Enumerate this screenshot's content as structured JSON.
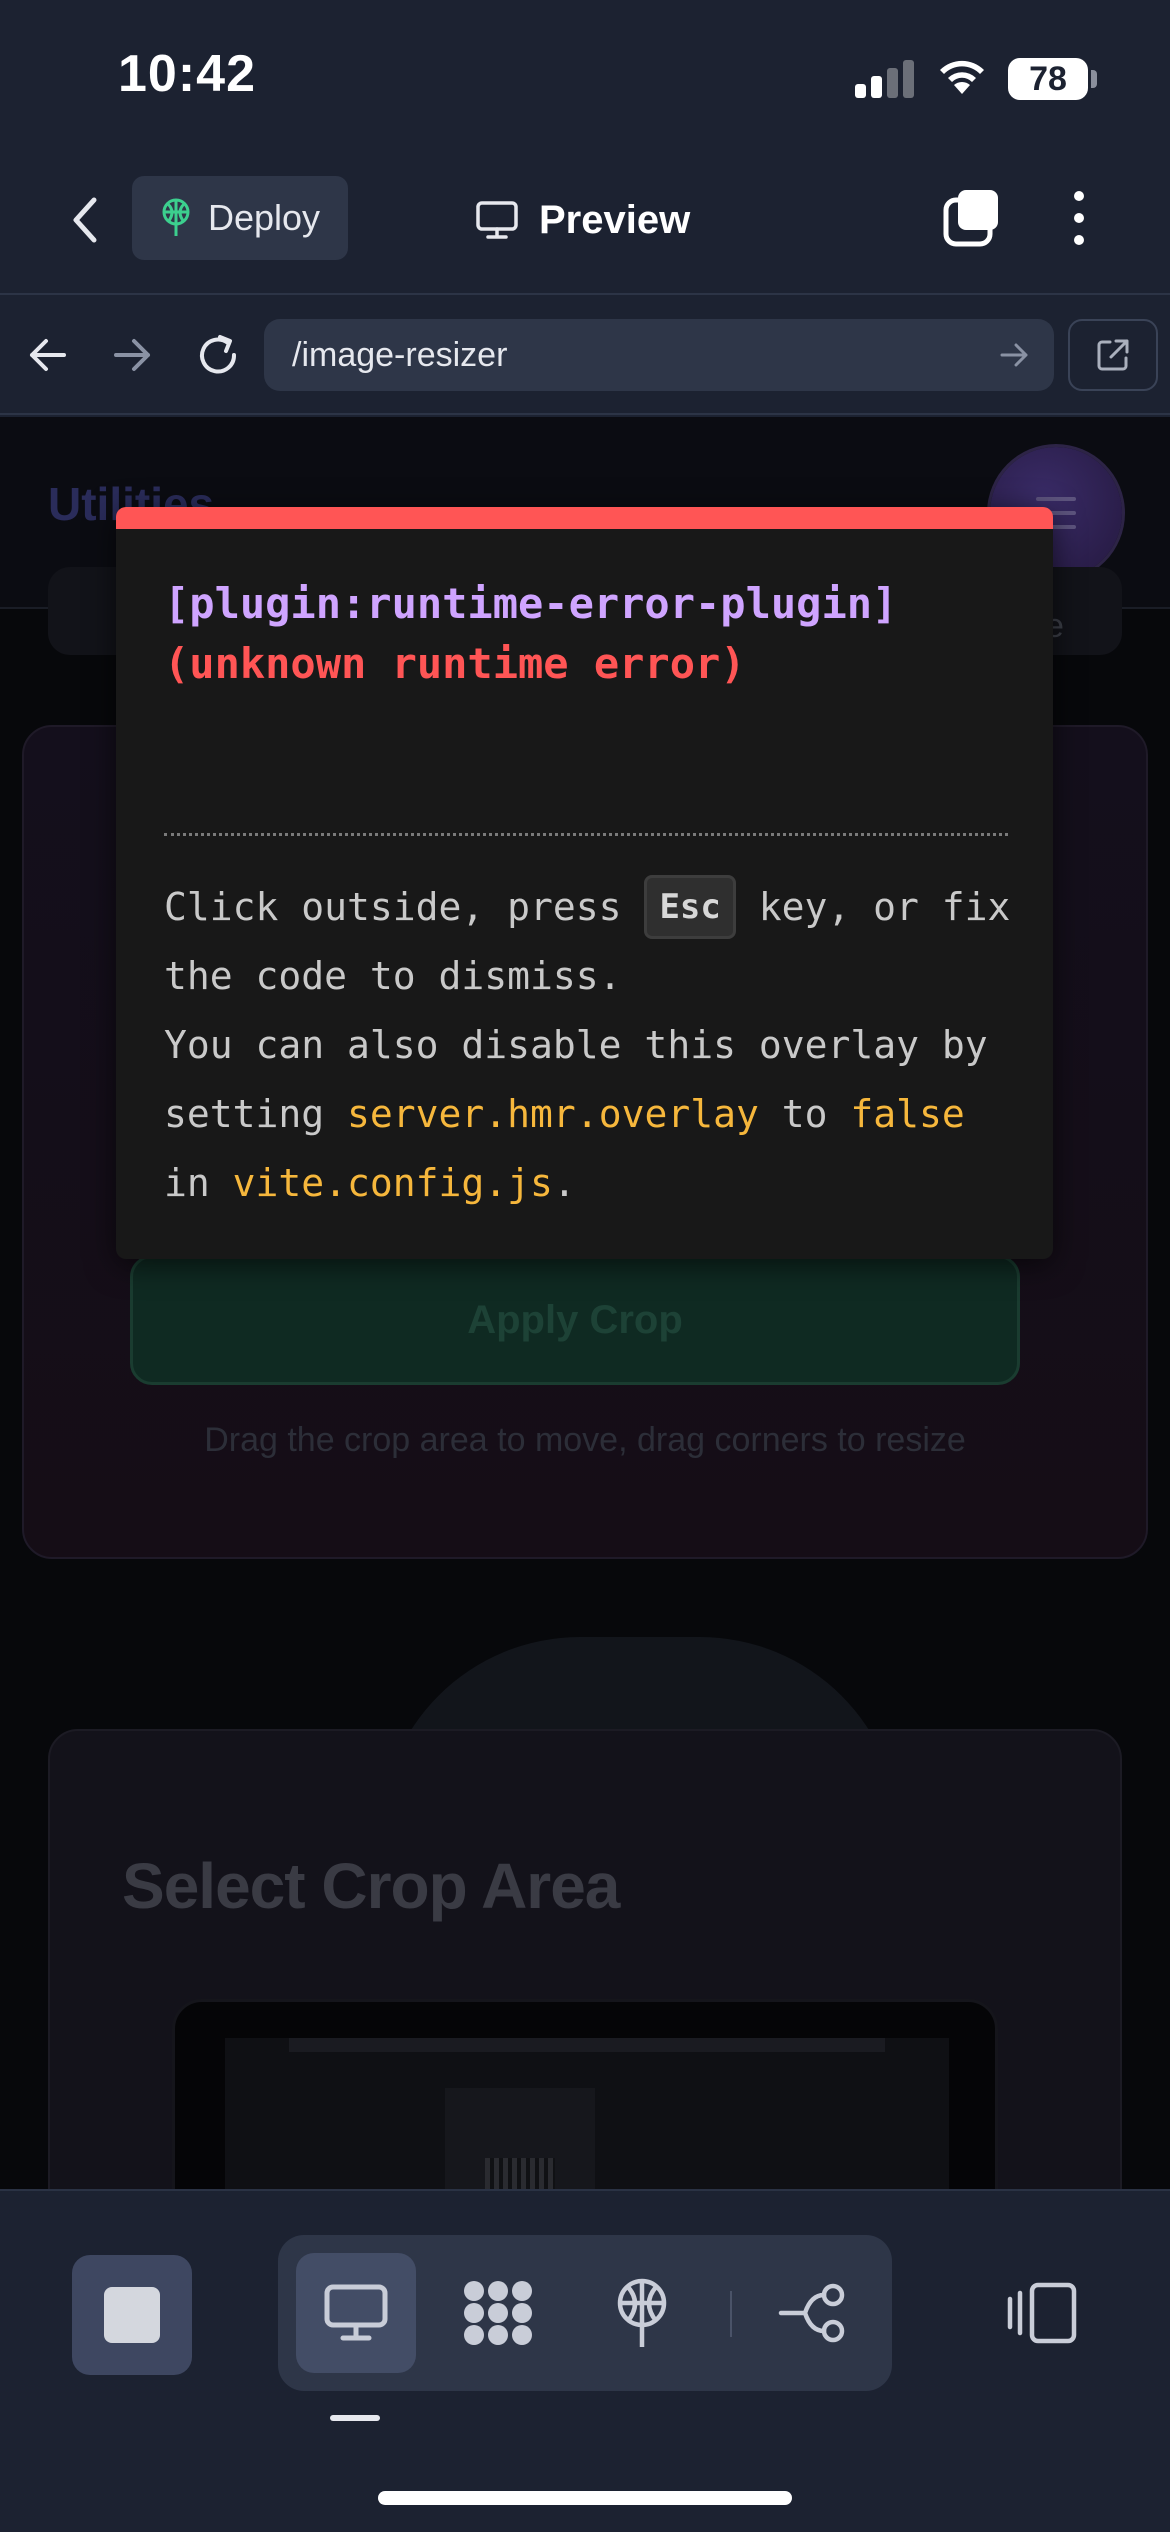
{
  "status_bar": {
    "time": "10:42",
    "battery": "78"
  },
  "app_bar": {
    "deploy_label": "Deploy",
    "preview_label": "Preview"
  },
  "url_bar": {
    "path": "/image-resizer"
  },
  "site": {
    "logo": "Utilities",
    "apply_crop_label": "Apply Crop",
    "crop_hint": "Drag the crop area to move, drag corners to resize",
    "select_crop_title": "Select Crop Area"
  },
  "error_overlay": {
    "plugin": "[plugin:runtime-error-plugin]",
    "message": "(unknown runtime error)",
    "tip_part1": "Click outside, press ",
    "tip_key": "Esc",
    "tip_part2": " key, or fix the code to dismiss.",
    "tip_part3": "You can also disable this overlay by setting ",
    "tip_code1": "server.hmr.overlay",
    "tip_part4": " to ",
    "tip_code2": "false",
    "tip_part5": " in ",
    "tip_code3": "vite.config.js",
    "tip_part6": ".",
    "accent_color": "#ff5555",
    "plugin_color": "#cfa4ff",
    "code_color": "#f6b73c"
  },
  "bottom_bar": {
    "tools": [
      "monitor-icon",
      "apps-grid-icon",
      "deploy-icon",
      "connect-nodes-icon"
    ],
    "active_tool": "monitor-icon"
  }
}
